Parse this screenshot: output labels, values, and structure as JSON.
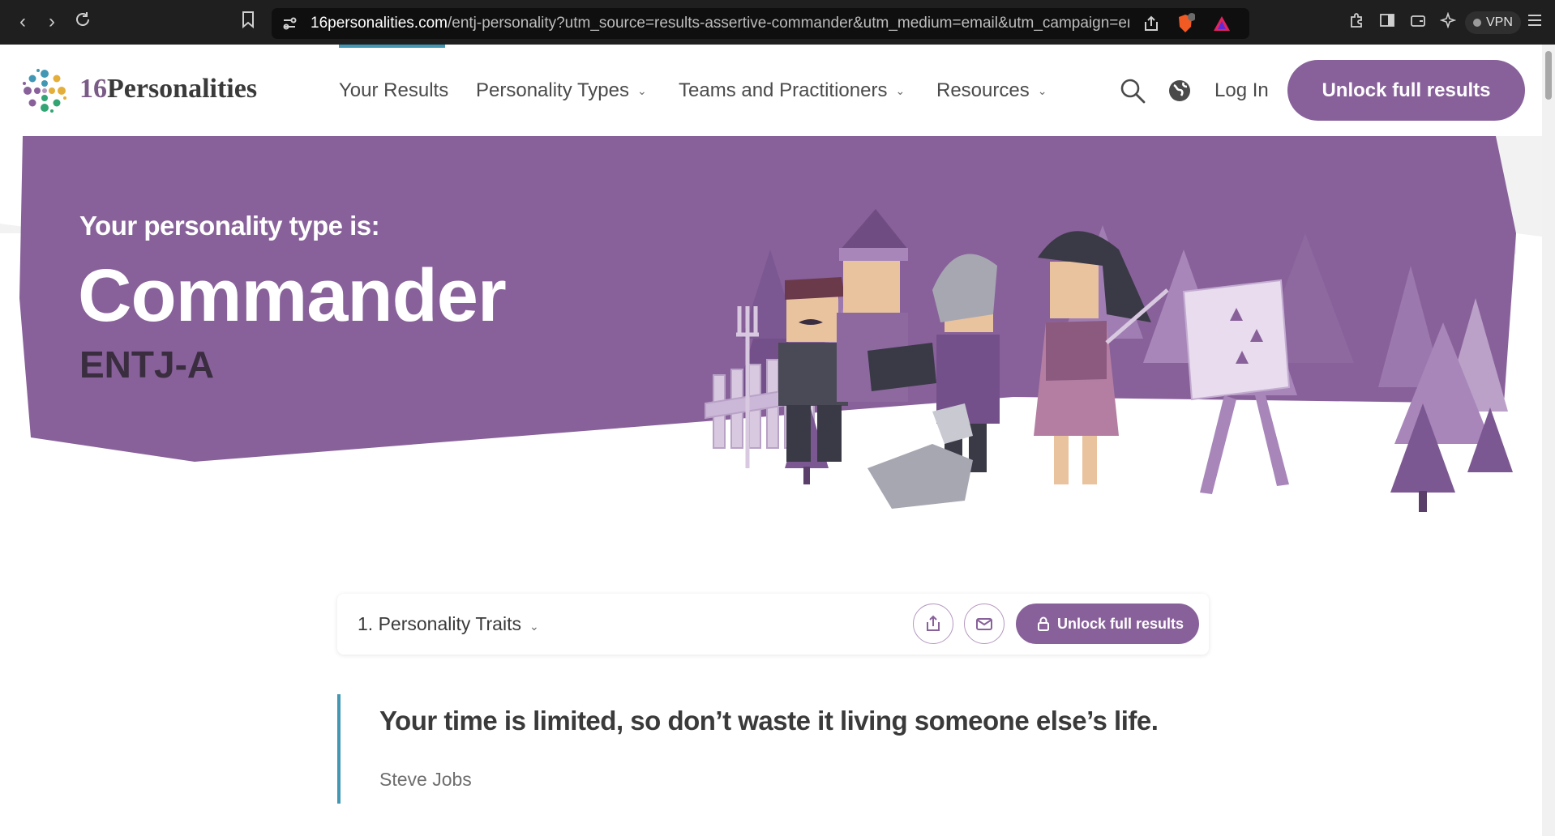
{
  "browser": {
    "url_host": "16personalities.com",
    "url_path": "/entj-personality?utm_source=results-assertive-commander&utm_medium=email&utm_campaign=en&utm_...",
    "vpn_label": "VPN"
  },
  "header": {
    "logo_number": "16",
    "logo_word": "Personalities",
    "nav": {
      "your_results": "Your Results",
      "personality_types": "Personality Types",
      "teams": "Teams and Practitioners",
      "resources": "Resources"
    },
    "login": "Log In",
    "unlock_button": "Unlock full results"
  },
  "hero": {
    "subtitle": "Your personality type is:",
    "title": "Commander",
    "code": "ENTJ-A"
  },
  "section_bar": {
    "title": "1. Personality Traits",
    "unlock_button": "Unlock full results"
  },
  "quote": {
    "text": "Your time is limited, so don’t waste it living someone else’s life.",
    "author": "Steve Jobs"
  },
  "colors": {
    "brand_purple": "#88619a",
    "accent_teal": "#4298b4",
    "chrome_bg": "#1f1f1f"
  }
}
